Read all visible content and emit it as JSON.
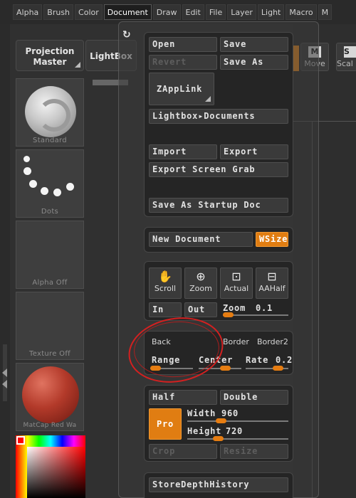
{
  "menu": [
    "Alpha",
    "Brush",
    "Color",
    "Document",
    "Draw",
    "Edit",
    "File",
    "Layer",
    "Light",
    "Macro",
    "M"
  ],
  "menu_active": "Document",
  "left_palette": {
    "projection_master": "Projection\nMaster",
    "lightbox": "LightBox",
    "brush_caption": "Standard",
    "stroke_caption": "Dots",
    "alpha_caption": "Alpha  Off",
    "texture_caption": "Texture  Off",
    "material_caption": "MatCap  Red  Wa"
  },
  "right_palette": {
    "move_label": "Move",
    "scale_label": "Scal"
  },
  "document_menu": {
    "open": "Open",
    "save": "Save",
    "revert": "Revert",
    "save_as": "Save As",
    "zapplink": "ZAppLink",
    "lightbox_documents": "Lightbox▸Documents",
    "import": "Import",
    "export": "Export",
    "export_screen_grab": "Export Screen Grab",
    "save_as_startup_doc": "Save As Startup Doc",
    "new_document": "New Document",
    "wsize": "WSize",
    "scroll": "Scroll",
    "zoom": "Zoom",
    "actual": "Actual",
    "aahalf": "AAHalf",
    "in": "In",
    "out": "Out",
    "zoom_slider_label": "Zoom",
    "zoom_value": "0.1",
    "back": "Back",
    "border": "Border",
    "border2": "Border2",
    "range": "Range",
    "center": "Center",
    "rate_label": "Rate",
    "rate_value": "0.2",
    "half": "Half",
    "double": "Double",
    "pro": "Pro",
    "width_label": "Width",
    "width_value": "960",
    "height_label": "Height",
    "height_value": "720",
    "crop": "Crop",
    "resize": "Resize",
    "store_depth_history": "StoreDepthHistory"
  },
  "colors": {
    "accent_orange": "#e07d12",
    "annotation_red": "#d42020"
  }
}
